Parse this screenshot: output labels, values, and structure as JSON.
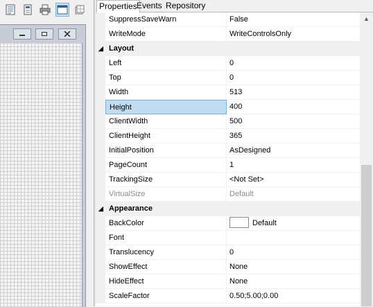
{
  "toolbar": {
    "buttons": [
      {
        "icon": "properties-list-icon"
      },
      {
        "icon": "document-icon"
      },
      {
        "icon": "printer-icon"
      },
      {
        "icon": "form-window-icon"
      },
      {
        "icon": "grid-toggle-icon"
      }
    ]
  },
  "designer": {
    "caption_buttons": [
      {
        "icon": "minimize-icon"
      },
      {
        "icon": "maximize-icon"
      },
      {
        "icon": "close-icon"
      }
    ]
  },
  "inspector": {
    "tabs": [
      {
        "label": "Properties",
        "active": true
      },
      {
        "label": "Events",
        "active": false
      },
      {
        "label": "Repository",
        "active": false
      }
    ],
    "rows_top": [
      {
        "name": "SuppressSaveWarn",
        "value": "False"
      },
      {
        "name": "WriteMode",
        "value": "WriteControlsOnly"
      }
    ],
    "layout": {
      "title": "Layout",
      "rows": [
        {
          "name": "Left",
          "value": "0"
        },
        {
          "name": "Top",
          "value": "0"
        },
        {
          "name": "Width",
          "value": "513"
        },
        {
          "name": "Height",
          "value": "400"
        },
        {
          "name": "ClientWidth",
          "value": "500"
        },
        {
          "name": "ClientHeight",
          "value": "365"
        },
        {
          "name": "InitialPosition",
          "value": "AsDesigned"
        },
        {
          "name": "PageCount",
          "value": "1"
        },
        {
          "name": "TrackingSize",
          "value": "<Not Set>"
        },
        {
          "name": "VirtualSize",
          "value": "Default"
        }
      ]
    },
    "appearance": {
      "title": "Appearance",
      "rows": [
        {
          "name": "BackColor",
          "value": "Default"
        },
        {
          "name": "Font",
          "value": ""
        },
        {
          "name": "Translucency",
          "value": "0"
        },
        {
          "name": "ShowEffect",
          "value": "None"
        },
        {
          "name": "HideEffect",
          "value": "None"
        },
        {
          "name": "ScaleFactor",
          "value": "0.50;5.00;0.00"
        }
      ]
    }
  },
  "colors": {
    "selection_fill": "#c0dcf0",
    "selection_border": "#7ab0d8",
    "backcolor_swatch": "#ffffff"
  }
}
